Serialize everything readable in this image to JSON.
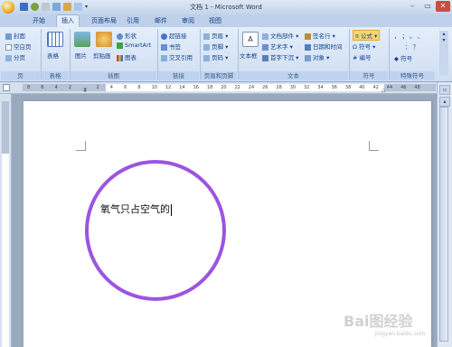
{
  "window": {
    "title": "文档 1 - Microsoft Word"
  },
  "tabs": [
    {
      "label": "开始"
    },
    {
      "label": "插入"
    },
    {
      "label": "页面布局"
    },
    {
      "label": "引用"
    },
    {
      "label": "邮件"
    },
    {
      "label": "审阅"
    },
    {
      "label": "视图"
    }
  ],
  "ribbon": {
    "pages": {
      "cover": "封面",
      "blank": "空白页",
      "break": "分页",
      "label": "页"
    },
    "table": {
      "table": "表格",
      "label": "表格"
    },
    "illustrations": {
      "picture": "图片",
      "clipart": "剪贴画",
      "shapes": "形状",
      "smartart": "SmartArt",
      "chart": "图表",
      "label": "插图"
    },
    "links": {
      "hyperlink": "超链接",
      "bookmark": "书签",
      "crossref": "交叉引用",
      "label": "链接"
    },
    "header_footer": {
      "header": "页眉",
      "footer": "页脚",
      "pagenum": "页码",
      "label": "页眉和页脚"
    },
    "text": {
      "textbox": "文本框",
      "quickparts": "文档部件",
      "wordart": "艺术字",
      "dropcap": "首字下沉",
      "signature": "签名行",
      "datetime": "日期和时间",
      "object": "对象",
      "label": "文本"
    },
    "symbols": {
      "equation": "π 公式",
      "symbol": "Ω 符号",
      "number": "# 编号",
      "label": "符号"
    },
    "special": {
      "row1": "，  ；  。  、",
      "row2": "：  ？",
      "row3": "◆ 符号",
      "label": "特殊符号"
    }
  },
  "ruler": {
    "numbers": [
      "8",
      "6",
      "4",
      "2",
      "",
      "2",
      "4",
      "6",
      "8",
      "10",
      "12",
      "14",
      "16",
      "18",
      "20",
      "22",
      "24",
      "26",
      "28",
      "30",
      "32",
      "34",
      "36",
      "38",
      "40",
      "42",
      "44",
      "46",
      "48"
    ]
  },
  "document": {
    "text": "氧气只占空气的"
  },
  "watermark": {
    "main": "Bai图经验",
    "sub": "jingyan.baidu.com"
  },
  "colors": {
    "circle": "#9b55e0"
  }
}
